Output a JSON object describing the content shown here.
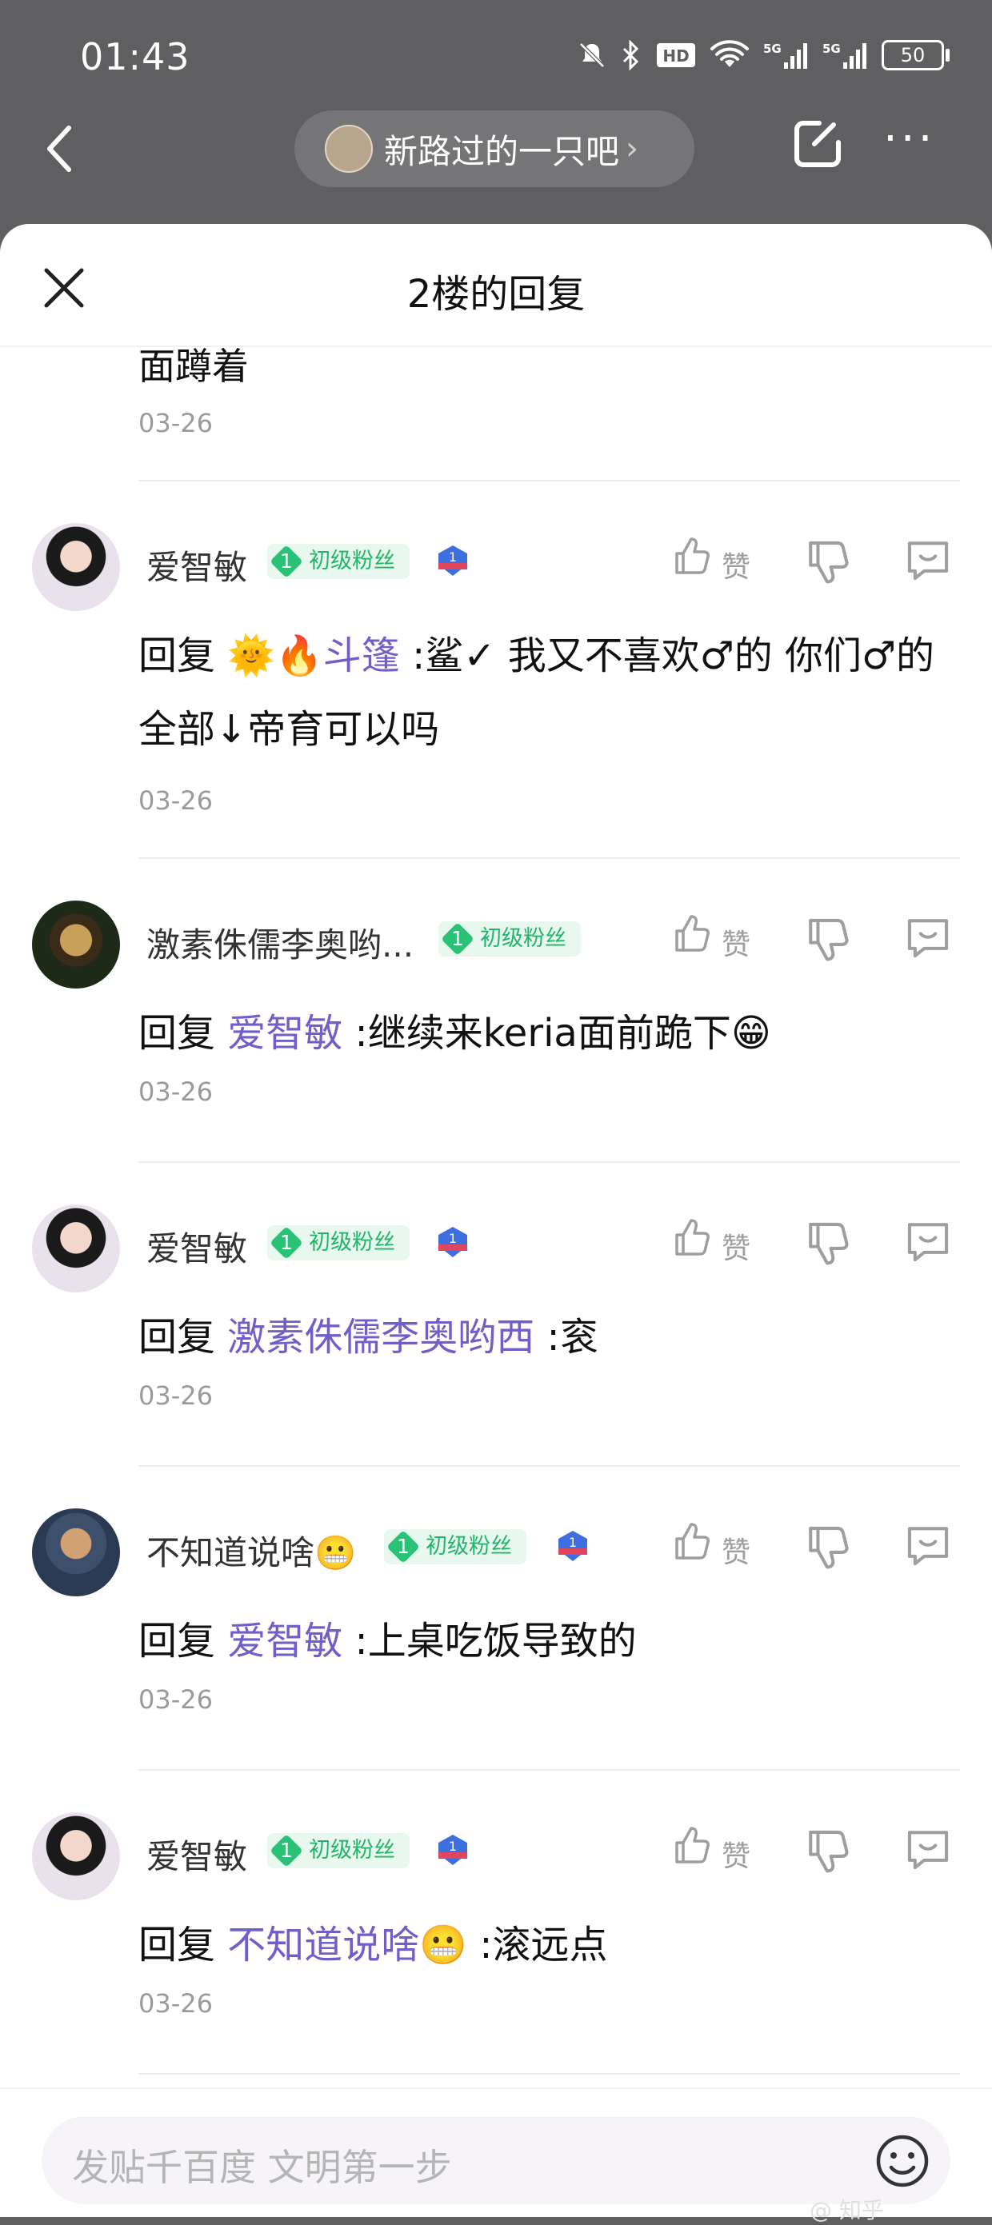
{
  "status_bar": {
    "time": "01:43",
    "battery": "50",
    "icons": [
      "mute-icon",
      "bluetooth-icon",
      "hd-icon",
      "wifi-icon",
      "5g-signal-icon",
      "5g-signal-icon",
      "battery-icon"
    ]
  },
  "nav": {
    "forum_name": "新路过的一只吧",
    "chevron": "›",
    "more": "···"
  },
  "sheet": {
    "title": "2楼的回复"
  },
  "partial": {
    "text": "面蹲着",
    "date": "03-26"
  },
  "badge_label": "初级粉丝",
  "badge_level": "1",
  "like_label": "赞",
  "replies": [
    {
      "user": "爱智敏",
      "prefix": "回复 ",
      "emoji": "🌞🔥",
      "mention": "斗篷",
      "text": ":鲨✓ 我又不喜欢♂的 你们♂的全部↓帝育可以吗",
      "date": "03-26",
      "has_level_icon": true
    },
    {
      "user": "激素侏儒李奥哟...",
      "prefix": "回复 ",
      "mention": "爱智敏",
      "text": ":继续来keria面前跪下😁",
      "date": "03-26",
      "has_level_icon": false
    },
    {
      "user": "爱智敏",
      "prefix": "回复 ",
      "mention": "激素侏儒李奥哟西",
      "text": ":衮",
      "date": "03-26",
      "has_level_icon": true
    },
    {
      "user": "不知道说啥😬",
      "prefix": "回复 ",
      "mention": "爱智敏",
      "text": ":上桌吃饭导致的",
      "date": "03-26",
      "has_level_icon": true
    },
    {
      "user": "爱智敏",
      "prefix": "回复 ",
      "mention": "不知道说啥😬",
      "text": ":滚远点",
      "date": "03-26",
      "has_level_icon": true
    }
  ],
  "input": {
    "placeholder": "发贴千百度 文明第一步"
  },
  "watermark": "@ 知乎"
}
